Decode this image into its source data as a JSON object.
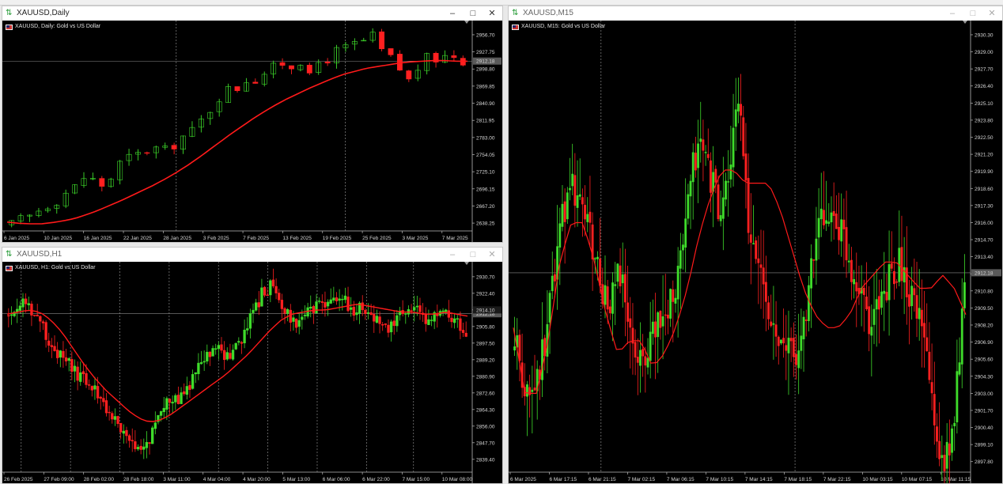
{
  "windows": {
    "daily": {
      "title": "XAUUSD,Daily",
      "label": "XAUUSD, Daily: Gold vs US Dollar",
      "current_price": "2912.18"
    },
    "h1": {
      "title": "XAUUSD,H1",
      "label": "XAUUSD, H1: Gold vs US Dollar",
      "current_price": "2912.18",
      "nearby_price": "2914.10"
    },
    "m15": {
      "title": "XAUUSD,M15",
      "label": "XAUUSD, M15: Gold vs US Dollar",
      "current_price": "2912.18"
    }
  },
  "chart_data": [
    {
      "type": "candlestick",
      "symbol": "XAUUSD",
      "timeframe": "Daily",
      "y_ticks": [
        "2956.70",
        "2927.75",
        "2898.80",
        "2869.85",
        "2840.90",
        "2811.95",
        "2783.00",
        "2754.05",
        "2725.10",
        "2696.15",
        "2667.20",
        "2638.25"
      ],
      "x_ticks": [
        "6 Jan 2025",
        "10 Jan 2025",
        "16 Jan 2025",
        "22 Jan 2025",
        "28 Jan 2025",
        "3 Feb 2025",
        "7 Feb 2025",
        "13 Feb 2025",
        "19 Feb 2025",
        "25 Feb 2025",
        "3 Mar 2025",
        "7 Mar 2025"
      ],
      "ylim": [
        2625,
        2970
      ],
      "overlay": "moving average (red)",
      "close_series": [
        2637,
        2645,
        2650,
        2660,
        2668,
        2675,
        2690,
        2700,
        2715,
        2712,
        2702,
        2714,
        2740,
        2750,
        2755,
        2760,
        2765,
        2762,
        2770,
        2785,
        2795,
        2812,
        2830,
        2850,
        2865,
        2866,
        2880,
        2880,
        2892,
        2902,
        2908,
        2903,
        2912,
        2885,
        2910,
        2915,
        2930,
        2935,
        2942,
        2946,
        2955,
        2930,
        2918,
        2898,
        2880,
        2900,
        2918,
        2915,
        2921,
        2921,
        2912
      ],
      "ma_series": [
        2640,
        2638,
        2637,
        2637,
        2639,
        2642,
        2646,
        2652,
        2659,
        2667,
        2675,
        2684,
        2693,
        2702,
        2712,
        2723,
        2735,
        2748,
        2762,
        2776,
        2790,
        2803,
        2816,
        2828,
        2839,
        2849,
        2858,
        2867,
        2875,
        2883,
        2890,
        2895,
        2900,
        2903,
        2906,
        2909,
        2911,
        2912,
        2913,
        2913,
        2912,
        2912
      ]
    },
    {
      "type": "candlestick",
      "symbol": "XAUUSD",
      "timeframe": "H1",
      "y_ticks": [
        "2930.70",
        "2922.40",
        "2914.10",
        "2905.80",
        "2897.50",
        "2889.20",
        "2880.90",
        "2872.60",
        "2864.30",
        "2856.00",
        "2847.70",
        "2839.40"
      ],
      "x_ticks": [
        "26 Feb 2025",
        "27 Feb 09:00",
        "28 Feb 02:00",
        "28 Feb 18:00",
        "3 Mar 11:00",
        "4 Mar 04:00",
        "4 Mar 20:00",
        "5 Mar 13:00",
        "6 Mar 06:00",
        "6 Mar 22:00",
        "7 Mar 15:00",
        "10 Mar 08:00"
      ],
      "ylim": [
        2833,
        2935
      ],
      "overlay": "moving average (red)",
      "close_series": [
        2912,
        2916,
        2918,
        2912,
        2905,
        2895,
        2890,
        2886,
        2880,
        2878,
        2873,
        2866,
        2860,
        2852,
        2846,
        2842,
        2850,
        2862,
        2870,
        2868,
        2872,
        2880,
        2888,
        2892,
        2894,
        2890,
        2896,
        2905,
        2914,
        2924,
        2926,
        2918,
        2910,
        2908,
        2912,
        2915,
        2917,
        2920,
        2920,
        2914,
        2916,
        2912,
        2910,
        2905,
        2908,
        2915,
        2916,
        2910,
        2908,
        2913,
        2911,
        2908,
        2902
      ],
      "ma_series": [
        2912,
        2913,
        2914,
        2913,
        2909,
        2903,
        2895,
        2887,
        2880,
        2874,
        2869,
        2864,
        2860,
        2858,
        2859,
        2862,
        2866,
        2870,
        2874,
        2878,
        2882,
        2887,
        2892,
        2898,
        2904,
        2909,
        2912,
        2913,
        2914,
        2914,
        2915,
        2916,
        2917,
        2916,
        2915,
        2914,
        2913,
        2913,
        2912,
        2912,
        2913,
        2912,
        2911
      ]
    },
    {
      "type": "candlestick",
      "symbol": "XAUUSD",
      "timeframe": "M15",
      "y_ticks": [
        "2930.30",
        "2929.00",
        "2927.70",
        "2926.40",
        "2925.10",
        "2923.80",
        "2922.50",
        "2921.20",
        "2919.90",
        "2918.60",
        "2917.30",
        "2916.00",
        "2914.70",
        "2913.40",
        "2912.10",
        "2910.80",
        "2909.50",
        "2908.20",
        "2906.90",
        "2905.60",
        "2904.30",
        "2903.00",
        "2901.70",
        "2900.40",
        "2899.10",
        "2897.80"
      ],
      "x_ticks": [
        "6 Mar 2025",
        "6 Mar 17:15",
        "6 Mar 21:15",
        "7 Mar 02:15",
        "7 Mar 06:15",
        "7 Mar 10:15",
        "7 Mar 14:15",
        "7 Mar 18:15",
        "7 Mar 22:15",
        "10 Mar 03:15",
        "10 Mar 07:15",
        "10 Mar 11:15"
      ],
      "ylim": [
        2897.0,
        2930.9
      ],
      "overlay": "moving average (red)",
      "close_series": [
        2907,
        2904,
        2903,
        2906,
        2911,
        2916,
        2919,
        2918,
        2915,
        2912,
        2909,
        2912,
        2910,
        2905,
        2906,
        2908,
        2909,
        2911,
        2914,
        2920,
        2922,
        2919,
        2917,
        2920,
        2926,
        2914,
        2913,
        2910,
        2906,
        2907,
        2905,
        2909,
        2914,
        2917,
        2916,
        2915,
        2912,
        2911,
        2908,
        2910,
        2912,
        2913,
        2911,
        2909,
        2906,
        2899,
        2898,
        2902,
        2911
      ],
      "ma_series": [
        2908,
        2903,
        2903,
        2907,
        2913,
        2916,
        2916,
        2913,
        2909,
        2906,
        2907,
        2907,
        2905,
        2906,
        2908,
        2911,
        2915,
        2918,
        2920,
        2920,
        2919,
        2919,
        2919,
        2917,
        2914,
        2911,
        2909,
        2908,
        2908,
        2909,
        2911,
        2912,
        2913,
        2913,
        2912,
        2911,
        2911,
        2912,
        2911,
        2909
      ]
    }
  ]
}
